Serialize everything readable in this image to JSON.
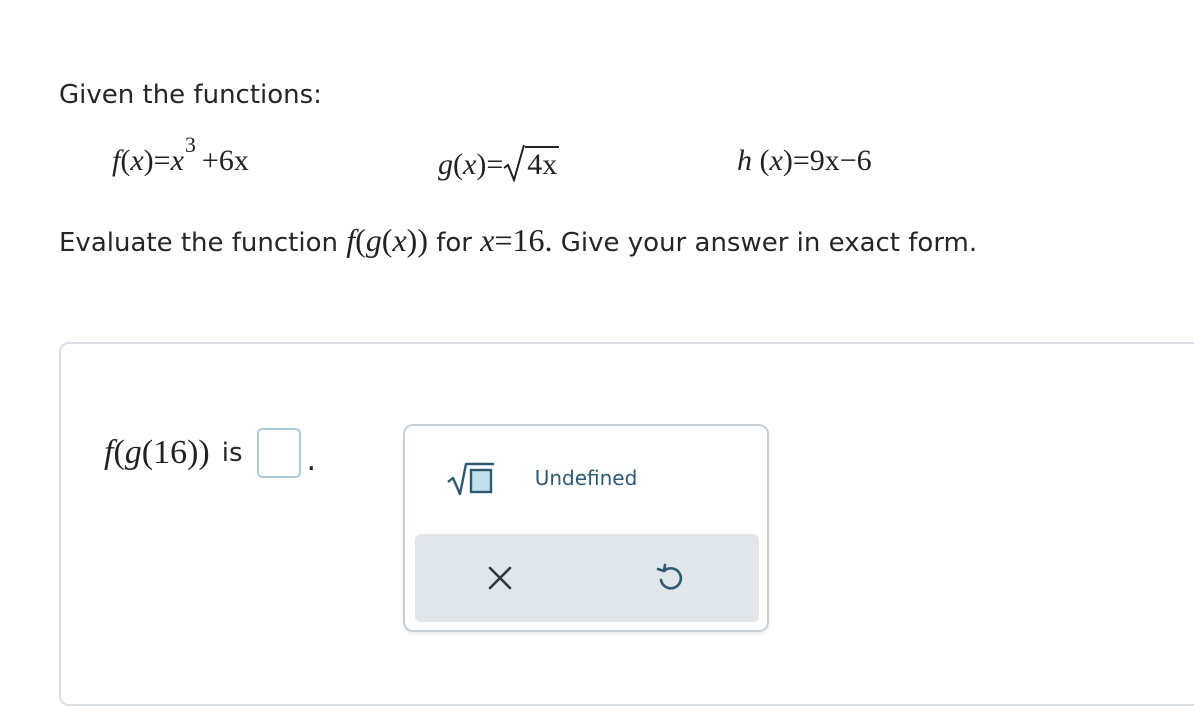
{
  "intro": "Given the functions:",
  "functions": {
    "f": {
      "name": "f",
      "var": "x",
      "equals": "=",
      "term1_base": "x",
      "term1_exp": "3",
      "plus": "+",
      "term2": "6x"
    },
    "g": {
      "name": "g",
      "var": "x",
      "equals": "=",
      "radicand": "4x"
    },
    "h": {
      "name": "h",
      "var": "x",
      "equals": "=",
      "rhs": "9x−6"
    }
  },
  "instruction": {
    "prefix": "Evaluate the function",
    "outer": "f",
    "inner": "g",
    "var": "x",
    "for_text": "for",
    "condition_var": "x",
    "condition_eq": "=",
    "condition_value": "16.",
    "suffix": "Give your answer in exact form."
  },
  "answer": {
    "outer": "f",
    "inner": "g",
    "arg": "16",
    "is_text": "is",
    "period": ".",
    "value": ""
  },
  "keypad": {
    "sqrt_icon": "square-root-template-icon",
    "undefined_label": "Undefined",
    "clear_icon": "x-icon",
    "undo_icon": "undo-icon"
  },
  "colors": {
    "accent": "#2d5a72",
    "answer_box_border": "#a9ccd9",
    "action_bar": "#e1e6ea"
  }
}
